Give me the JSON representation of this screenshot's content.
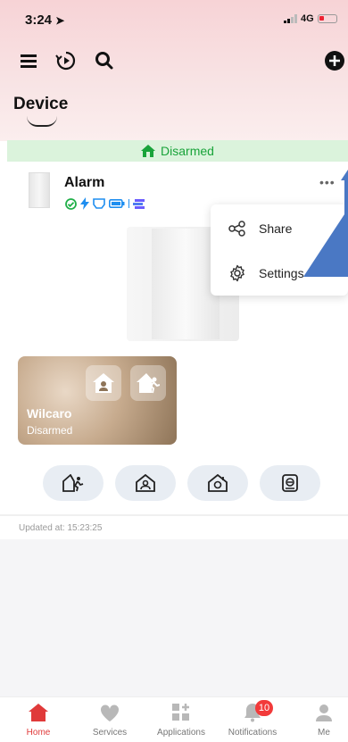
{
  "status_bar": {
    "time": "3:24",
    "network": "4G"
  },
  "header": {
    "title": "Device"
  },
  "state_banner": {
    "text": "Disarmed"
  },
  "device": {
    "name": "Alarm"
  },
  "menu": {
    "items": [
      {
        "label": "Share",
        "icon": "share-icon"
      },
      {
        "label": "Settings",
        "icon": "gear-icon"
      }
    ]
  },
  "scene": {
    "name": "Wilcaro",
    "state": "Disarmed"
  },
  "mode_buttons": [
    "away-arm-icon",
    "stay-arm-icon",
    "home-arm-icon",
    "disarm-icon"
  ],
  "updated": {
    "text": "Updated at: 15:23:25"
  },
  "tabbar": {
    "items": [
      {
        "label": "Home",
        "icon": "home-icon",
        "active": true
      },
      {
        "label": "Services",
        "icon": "heart-icon"
      },
      {
        "label": "Applications",
        "icon": "apps-icon"
      },
      {
        "label": "Notifications",
        "icon": "bell-icon",
        "badge": "10"
      },
      {
        "label": "Me",
        "icon": "person-icon"
      }
    ]
  },
  "colors": {
    "accent_red": "#e03a3a",
    "disarmed_green": "#19a33a",
    "callout_arrow": "#4a78c4"
  }
}
